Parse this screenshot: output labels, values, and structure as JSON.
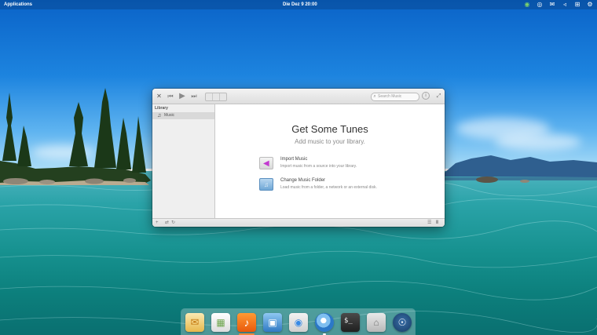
{
  "top_panel": {
    "applications_label": "Applications",
    "clock_label": "Die Dez  9   20:00",
    "tray": [
      {
        "name": "status-icon",
        "glyph": "◉"
      },
      {
        "name": "steam-tray-icon",
        "glyph": "◎"
      },
      {
        "name": "mail-tray-icon",
        "glyph": "✉"
      },
      {
        "name": "volume-icon",
        "glyph": "◃"
      },
      {
        "name": "network-icon",
        "glyph": "⊞"
      },
      {
        "name": "power-icon",
        "glyph": "⚙"
      }
    ]
  },
  "window": {
    "close_glyph": "✕",
    "prev_glyph": "⏮",
    "play_glyph": "▶",
    "next_glyph": "⏭",
    "search_placeholder": "Search Music",
    "search_glyph": "⌕",
    "info_glyph": "i",
    "maximize_glyph": "⤢",
    "sidebar": {
      "heading": "Library",
      "items": [
        {
          "label": "Music",
          "icon": "music-note-icon",
          "glyph": "♫"
        }
      ]
    },
    "welcome": {
      "title": "Get Some Tunes",
      "subtitle": "Add music to your library.",
      "options": [
        {
          "title": "Import Music",
          "description": "Import music from a source into your library."
        },
        {
          "title": "Change Music Folder",
          "description": "Load music from a folder, a network or an external disk."
        }
      ]
    },
    "statusbar": {
      "add_glyph": "+",
      "shuffle_glyph": "⇄",
      "repeat_glyph": "↻",
      "queue_glyph": "☰",
      "equalizer_glyph": "‖"
    }
  },
  "dock": {
    "items": [
      {
        "name": "dock-mail",
        "glyph": "✉"
      },
      {
        "name": "dock-calendar",
        "glyph": "▦"
      },
      {
        "name": "dock-music",
        "glyph": "♪"
      },
      {
        "name": "dock-photos",
        "glyph": "▣"
      },
      {
        "name": "dock-settings",
        "glyph": "◉"
      },
      {
        "name": "dock-browser",
        "glyph": ""
      },
      {
        "name": "dock-terminal",
        "glyph": "$_"
      },
      {
        "name": "dock-files",
        "glyph": "⌂"
      },
      {
        "name": "dock-steam",
        "glyph": "☉"
      }
    ]
  },
  "colors": {
    "panel_text": "#ffffff",
    "accent_music": "#e8590c",
    "import_arrow": "#c33bd0"
  }
}
